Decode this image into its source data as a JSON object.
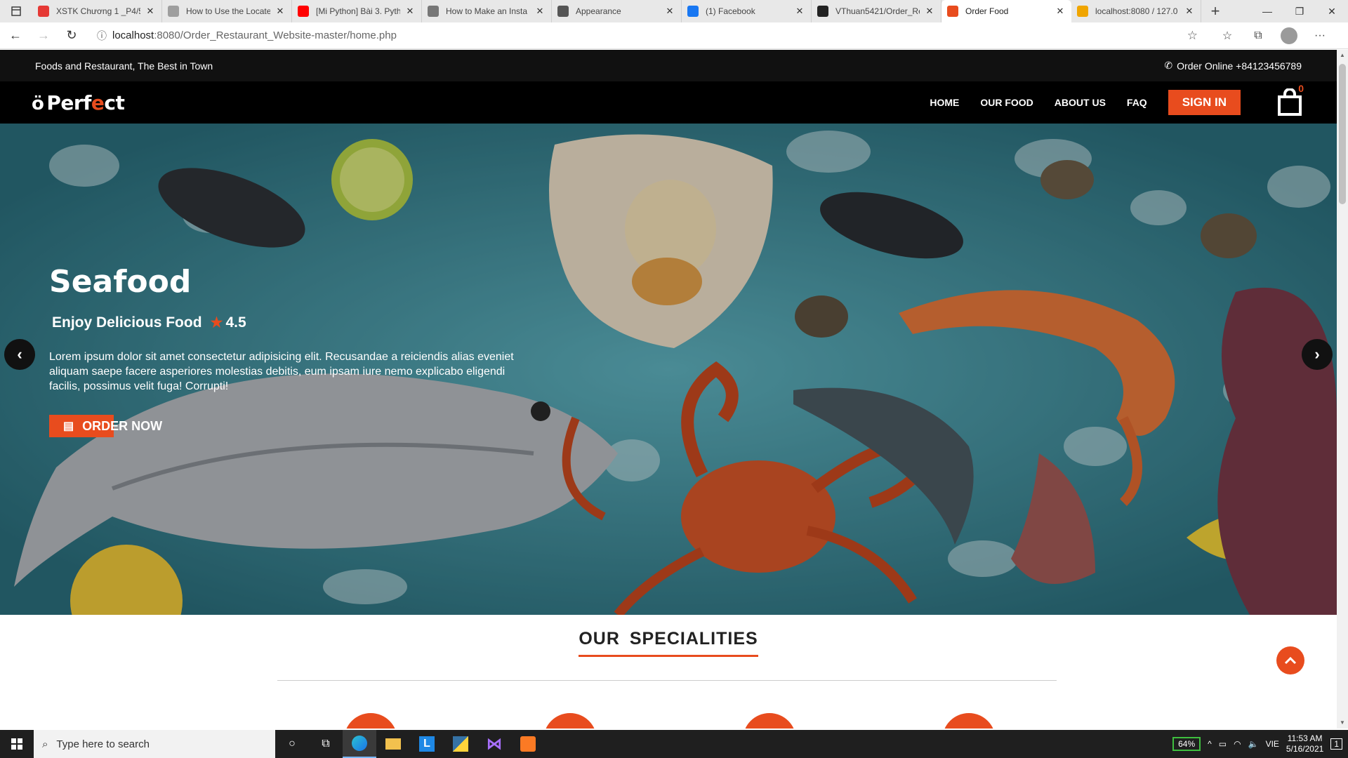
{
  "browser": {
    "tabs": [
      {
        "title": "XSTK Chương 1 _P4/5",
        "color": "#e53935",
        "glyph": "▶"
      },
      {
        "title": "How to Use the Locate",
        "color": "#9e9e9e",
        "glyph": "📄"
      },
      {
        "title": "[Mi Python] Bài 3. Pyth",
        "color": "#ff0000",
        "glyph": "▶"
      },
      {
        "title": "How to Make an Insta",
        "color": "#777777",
        "glyph": "○"
      },
      {
        "title": "Appearance",
        "color": "#555555",
        "glyph": "●"
      },
      {
        "title": "(1) Facebook",
        "color": "#1877f2",
        "glyph": "f"
      },
      {
        "title": "VThuan5421/Order_Re",
        "color": "#222222",
        "glyph": "●"
      },
      {
        "title": "Order Food",
        "color": "#e84c1e",
        "glyph": "⊠"
      },
      {
        "title": "localhost:8080 / 127.0",
        "color": "#f0a500",
        "glyph": "▲"
      }
    ],
    "active_tab": 7,
    "url_host": "localhost",
    "url_path": ":8080/Order_Restaurant_Website-master/home.php"
  },
  "site": {
    "topbar_text": "Foods and Restaurant, The Best in Town",
    "phone_text": "Order Online +84123456789",
    "logo_text_1": "Perf",
    "logo_text_e": "e",
    "logo_text_2": "ct",
    "nav": [
      "HOME",
      "OUR FOOD",
      "ABOUT US",
      "FAQ"
    ],
    "signin_label": "SIGN IN",
    "cart_count": "0"
  },
  "hero": {
    "title": "Seafood",
    "subtitle": "Enjoy Delicious Food",
    "rating": "4.5",
    "description": "Lorem ipsum dolor sit amet consectetur adipisicing elit. Recusandae a reiciendis alias eveniet aliquam saepe facere asperiores molestias debitis, eum ipsam iure nemo explicabo eligendi facilis, possimus velit fuga! Corrupti!",
    "button_label": "ORDER NOW"
  },
  "specialities": {
    "heading": "OUR  SPECIALITIES"
  },
  "taskbar": {
    "search_placeholder": "Type here to search",
    "battery": "64%",
    "language": "VIE",
    "time": "11:53 AM",
    "date": "5/16/2021",
    "notifications": "1"
  },
  "colors": {
    "accent": "#e84c1e",
    "topbar": "#111111",
    "navbar": "#000000"
  }
}
